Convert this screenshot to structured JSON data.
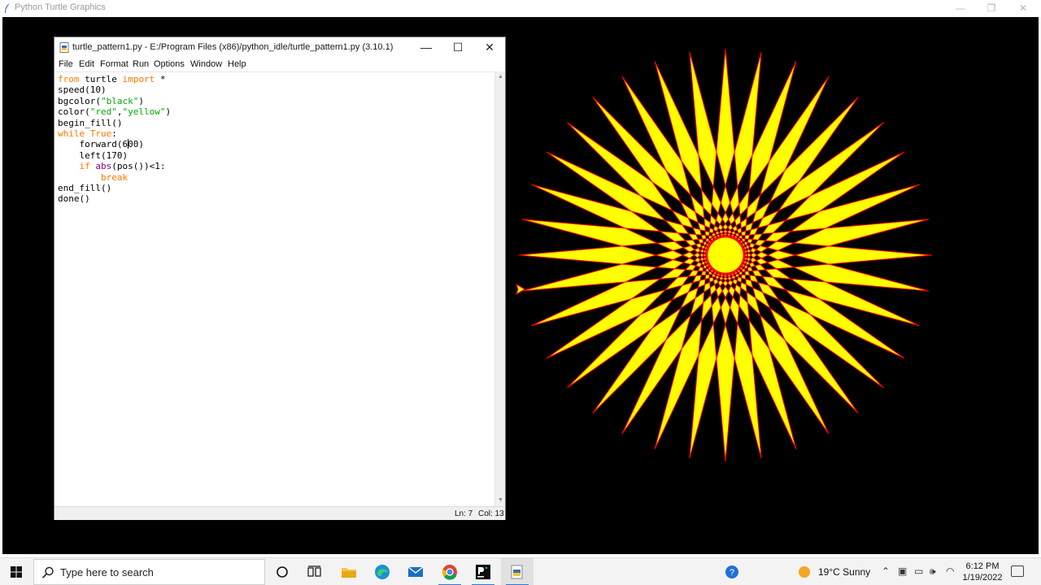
{
  "turtle_window": {
    "title": "Python Turtle Graphics",
    "background": "#000000",
    "pen_color": "#ff0000",
    "fill_color": "#ffff00"
  },
  "idle": {
    "title": "turtle_pattern1.py - E:/Program Files (x86)/python_idle/turtle_pattern1.py (3.10.1)",
    "menu": [
      "File",
      "Edit",
      "Format",
      "Run",
      "Options",
      "Window",
      "Help"
    ],
    "code_lines": [
      "from turtle import *",
      "speed(10)",
      "bgcolor(\"black\")",
      "color(\"red\",\"yellow\")",
      "begin_fill()",
      "while True:",
      "    forward(600)",
      "    left(170)",
      "    if abs(pos())<1:",
      "        break",
      "end_fill()",
      "done()"
    ],
    "status": {
      "line": "Ln: 7",
      "col": "Col: 13"
    }
  },
  "taskbar": {
    "search_placeholder": "Type here to search",
    "apps": [
      "cortana-icon",
      "task-view-icon",
      "file-explorer-icon",
      "edge-icon",
      "mail-icon",
      "chrome-icon",
      "pycharm-icon",
      "python-idle-icon"
    ],
    "weather": "19°C  Sunny",
    "time": "6:12 PM",
    "date": "1/19/2022"
  }
}
